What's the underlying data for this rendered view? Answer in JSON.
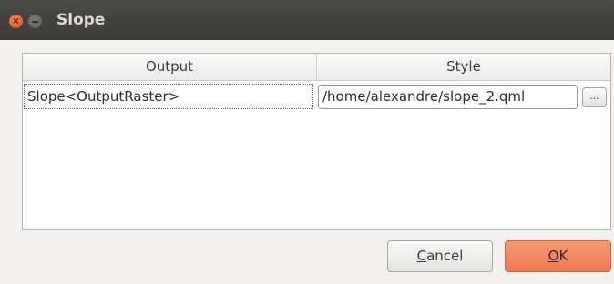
{
  "window": {
    "title": "Slope",
    "close_glyph": "×"
  },
  "table": {
    "columns": [
      "Output",
      "Style"
    ],
    "rows": [
      {
        "output": "Slope<OutputRaster>",
        "style": "/home/alexandre/slope_2.qml",
        "browse_label": "..."
      }
    ]
  },
  "buttons": {
    "cancel_mnemonic": "C",
    "cancel_rest": "ancel",
    "ok_mnemonic": "O",
    "ok_rest": "K"
  },
  "colors": {
    "titlebar": "#3c3b37",
    "close_button": "#df4a16",
    "ok_button": "#ef7a52"
  }
}
